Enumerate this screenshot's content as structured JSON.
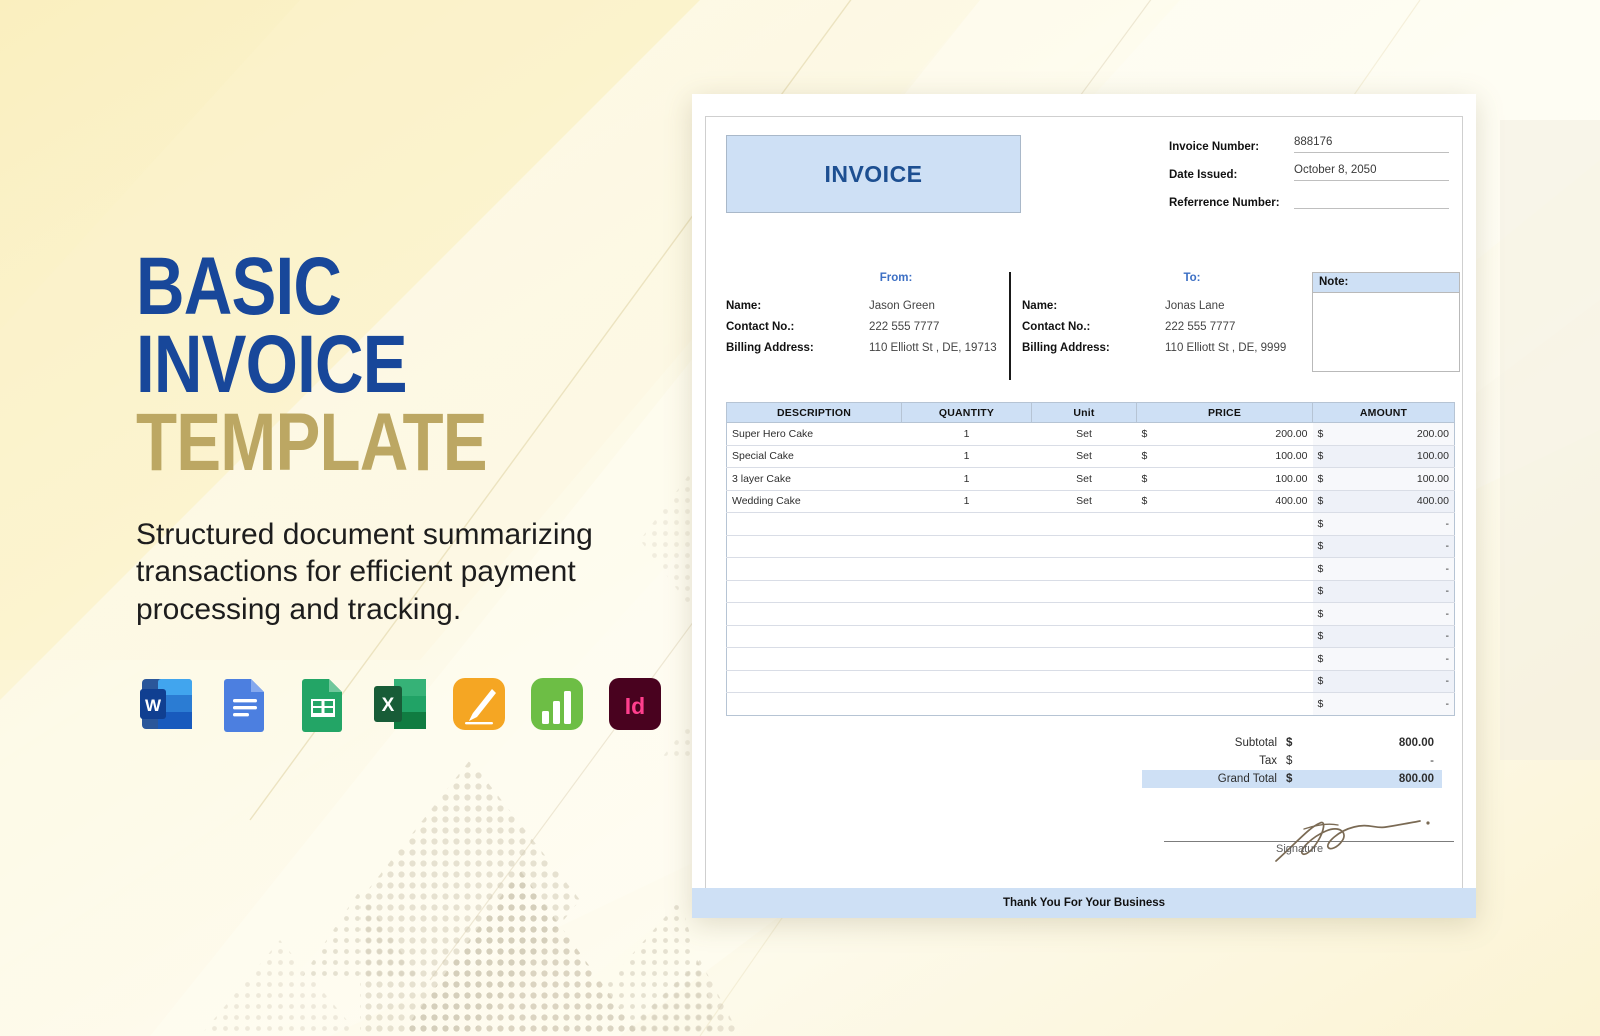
{
  "promo": {
    "title_line1": "BASIC",
    "title_line2": "INVOICE",
    "title_line3": "TEMPLATE",
    "subtitle": "Structured document summarizing transactions for efficient payment processing and tracking.",
    "title_color_primary": "#18479A",
    "title_color_accent": "#BCA763",
    "background_color": "#FAF4DC",
    "app_icons": [
      {
        "name": "microsoft-word-icon",
        "label": "W",
        "color": "#2B579A"
      },
      {
        "name": "google-docs-icon",
        "label": "",
        "color": "#4C7FE0"
      },
      {
        "name": "google-sheets-icon",
        "label": "",
        "color": "#23A566"
      },
      {
        "name": "microsoft-excel-icon",
        "label": "X",
        "color": "#1D6F42"
      },
      {
        "name": "apple-pages-icon",
        "label": "",
        "color": "#F5A623"
      },
      {
        "name": "apple-numbers-icon",
        "label": "",
        "color": "#6DBE45"
      },
      {
        "name": "adobe-indesign-icon",
        "label": "Id",
        "color": "#49021F"
      }
    ]
  },
  "invoice": {
    "title": "INVOICE",
    "meta": [
      {
        "label": "Invoice Number:",
        "value": "888176"
      },
      {
        "label": "Date Issued:",
        "value": "October 8, 2050"
      },
      {
        "label": "Referrence Number:",
        "value": ""
      }
    ],
    "from": {
      "heading": "From:",
      "rows": [
        {
          "label": "Name:",
          "value": "Jason Green"
        },
        {
          "label": "Contact No.:",
          "value": "222 555 7777"
        },
        {
          "label": "Billing Address:",
          "value": "110 Elliott St , DE, 19713"
        }
      ]
    },
    "to": {
      "heading": "To:",
      "rows": [
        {
          "label": "Name:",
          "value": "Jonas Lane"
        },
        {
          "label": "Contact No.:",
          "value": "222 555 7777"
        },
        {
          "label": "Billing Address:",
          "value": "110 Elliott St , DE, 9999"
        }
      ]
    },
    "note": {
      "heading": "Note:",
      "body": ""
    },
    "table": {
      "columns": [
        "DESCRIPTION",
        "QUANTITY",
        "Unit",
        "PRICE",
        "AMOUNT"
      ],
      "currency_symbol": "$",
      "rows": [
        {
          "description": "Super Hero Cake",
          "quantity": "1",
          "unit": "Set",
          "price": "200.00",
          "amount": "200.00"
        },
        {
          "description": "Special Cake",
          "quantity": "1",
          "unit": "Set",
          "price": "100.00",
          "amount": "100.00"
        },
        {
          "description": "3 layer Cake",
          "quantity": "1",
          "unit": "Set",
          "price": "100.00",
          "amount": "100.00"
        },
        {
          "description": "Wedding Cake",
          "quantity": "1",
          "unit": "Set",
          "price": "400.00",
          "amount": "400.00"
        },
        {
          "description": "",
          "quantity": "",
          "unit": "",
          "price": "",
          "amount": "-"
        },
        {
          "description": "",
          "quantity": "",
          "unit": "",
          "price": "",
          "amount": "-"
        },
        {
          "description": "",
          "quantity": "",
          "unit": "",
          "price": "",
          "amount": "-"
        },
        {
          "description": "",
          "quantity": "",
          "unit": "",
          "price": "",
          "amount": "-"
        },
        {
          "description": "",
          "quantity": "",
          "unit": "",
          "price": "",
          "amount": "-"
        },
        {
          "description": "",
          "quantity": "",
          "unit": "",
          "price": "",
          "amount": "-"
        },
        {
          "description": "",
          "quantity": "",
          "unit": "",
          "price": "",
          "amount": "-"
        },
        {
          "description": "",
          "quantity": "",
          "unit": "",
          "price": "",
          "amount": "-"
        },
        {
          "description": "",
          "quantity": "",
          "unit": "",
          "price": "",
          "amount": "-"
        }
      ]
    },
    "totals": [
      {
        "label": "Subtotal",
        "currency": "$",
        "value": "800.00"
      },
      {
        "label": "Tax",
        "currency": "$",
        "value": "-"
      },
      {
        "label": "Grand Total",
        "currency": "$",
        "value": "800.00"
      }
    ],
    "signature_label": "Signature",
    "footer_text": "Thank You For Your Business",
    "accent_color": "#CEE0F5",
    "title_color": "#1d4f91"
  }
}
